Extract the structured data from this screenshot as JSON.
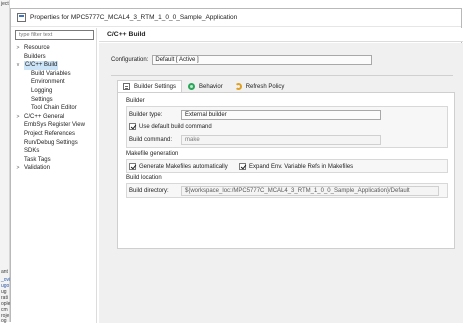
{
  "background_app": {
    "fragments": [
      "ject",
      "ant",
      "_ovi",
      "ugo",
      "ug",
      "rati",
      "ople",
      "cm",
      "roje",
      "og",
      "lole"
    ]
  },
  "window": {
    "title": "Properties for MPC5777C_MCAL4_3_RTM_1_0_0_Sample_Application"
  },
  "sidebar": {
    "filter_placeholder": "type filter text",
    "items": [
      {
        "label": "Resource",
        "arrow": ">"
      },
      {
        "label": "Builders",
        "arrow": ""
      },
      {
        "label": "C/C++ Build",
        "arrow": "v",
        "selected": true
      },
      {
        "label": "Build Variables",
        "child": true
      },
      {
        "label": "Environment",
        "child": true
      },
      {
        "label": "Logging",
        "child": true
      },
      {
        "label": "Settings",
        "child": true
      },
      {
        "label": "Tool Chain Editor",
        "child": true
      },
      {
        "label": "C/C++ General",
        "arrow": ">"
      },
      {
        "label": "EmbSys Register View",
        "arrow": ""
      },
      {
        "label": "Project References",
        "arrow": ""
      },
      {
        "label": "Run/Debug Settings",
        "arrow": ""
      },
      {
        "label": "SDKs",
        "arrow": ""
      },
      {
        "label": "Task Tags",
        "arrow": ""
      },
      {
        "label": "Validation",
        "arrow": ">"
      }
    ]
  },
  "page": {
    "title": "C/C++ Build",
    "configuration_label": "Configuration:",
    "configuration_value": "Default  [ Active ]",
    "tabs": [
      {
        "label": "Builder Settings",
        "icon": "settings-icon",
        "active": true
      },
      {
        "label": "Behavior",
        "icon": "behavior-icon"
      },
      {
        "label": "Refresh Policy",
        "icon": "refresh-icon"
      }
    ],
    "builder": {
      "group_title": "Builder",
      "type_label": "Builder type:",
      "type_value": "External builder",
      "use_default_label": "Use default build command",
      "use_default_checked": true,
      "command_label": "Build command:",
      "command_value": "make"
    },
    "makefile": {
      "group_title": "Makefile generation",
      "generate_label": "Generate Makefiles automatically",
      "generate_checked": true,
      "expand_label": "Expand Env. Variable Refs in Makefiles",
      "expand_checked": true
    },
    "location": {
      "group_title": "Build location",
      "dir_label": "Build directory:",
      "dir_value": "${workspace_loc:/MPC5777C_MCAL4_3_RTM_1_0_0_Sample_Application}/Default"
    }
  }
}
